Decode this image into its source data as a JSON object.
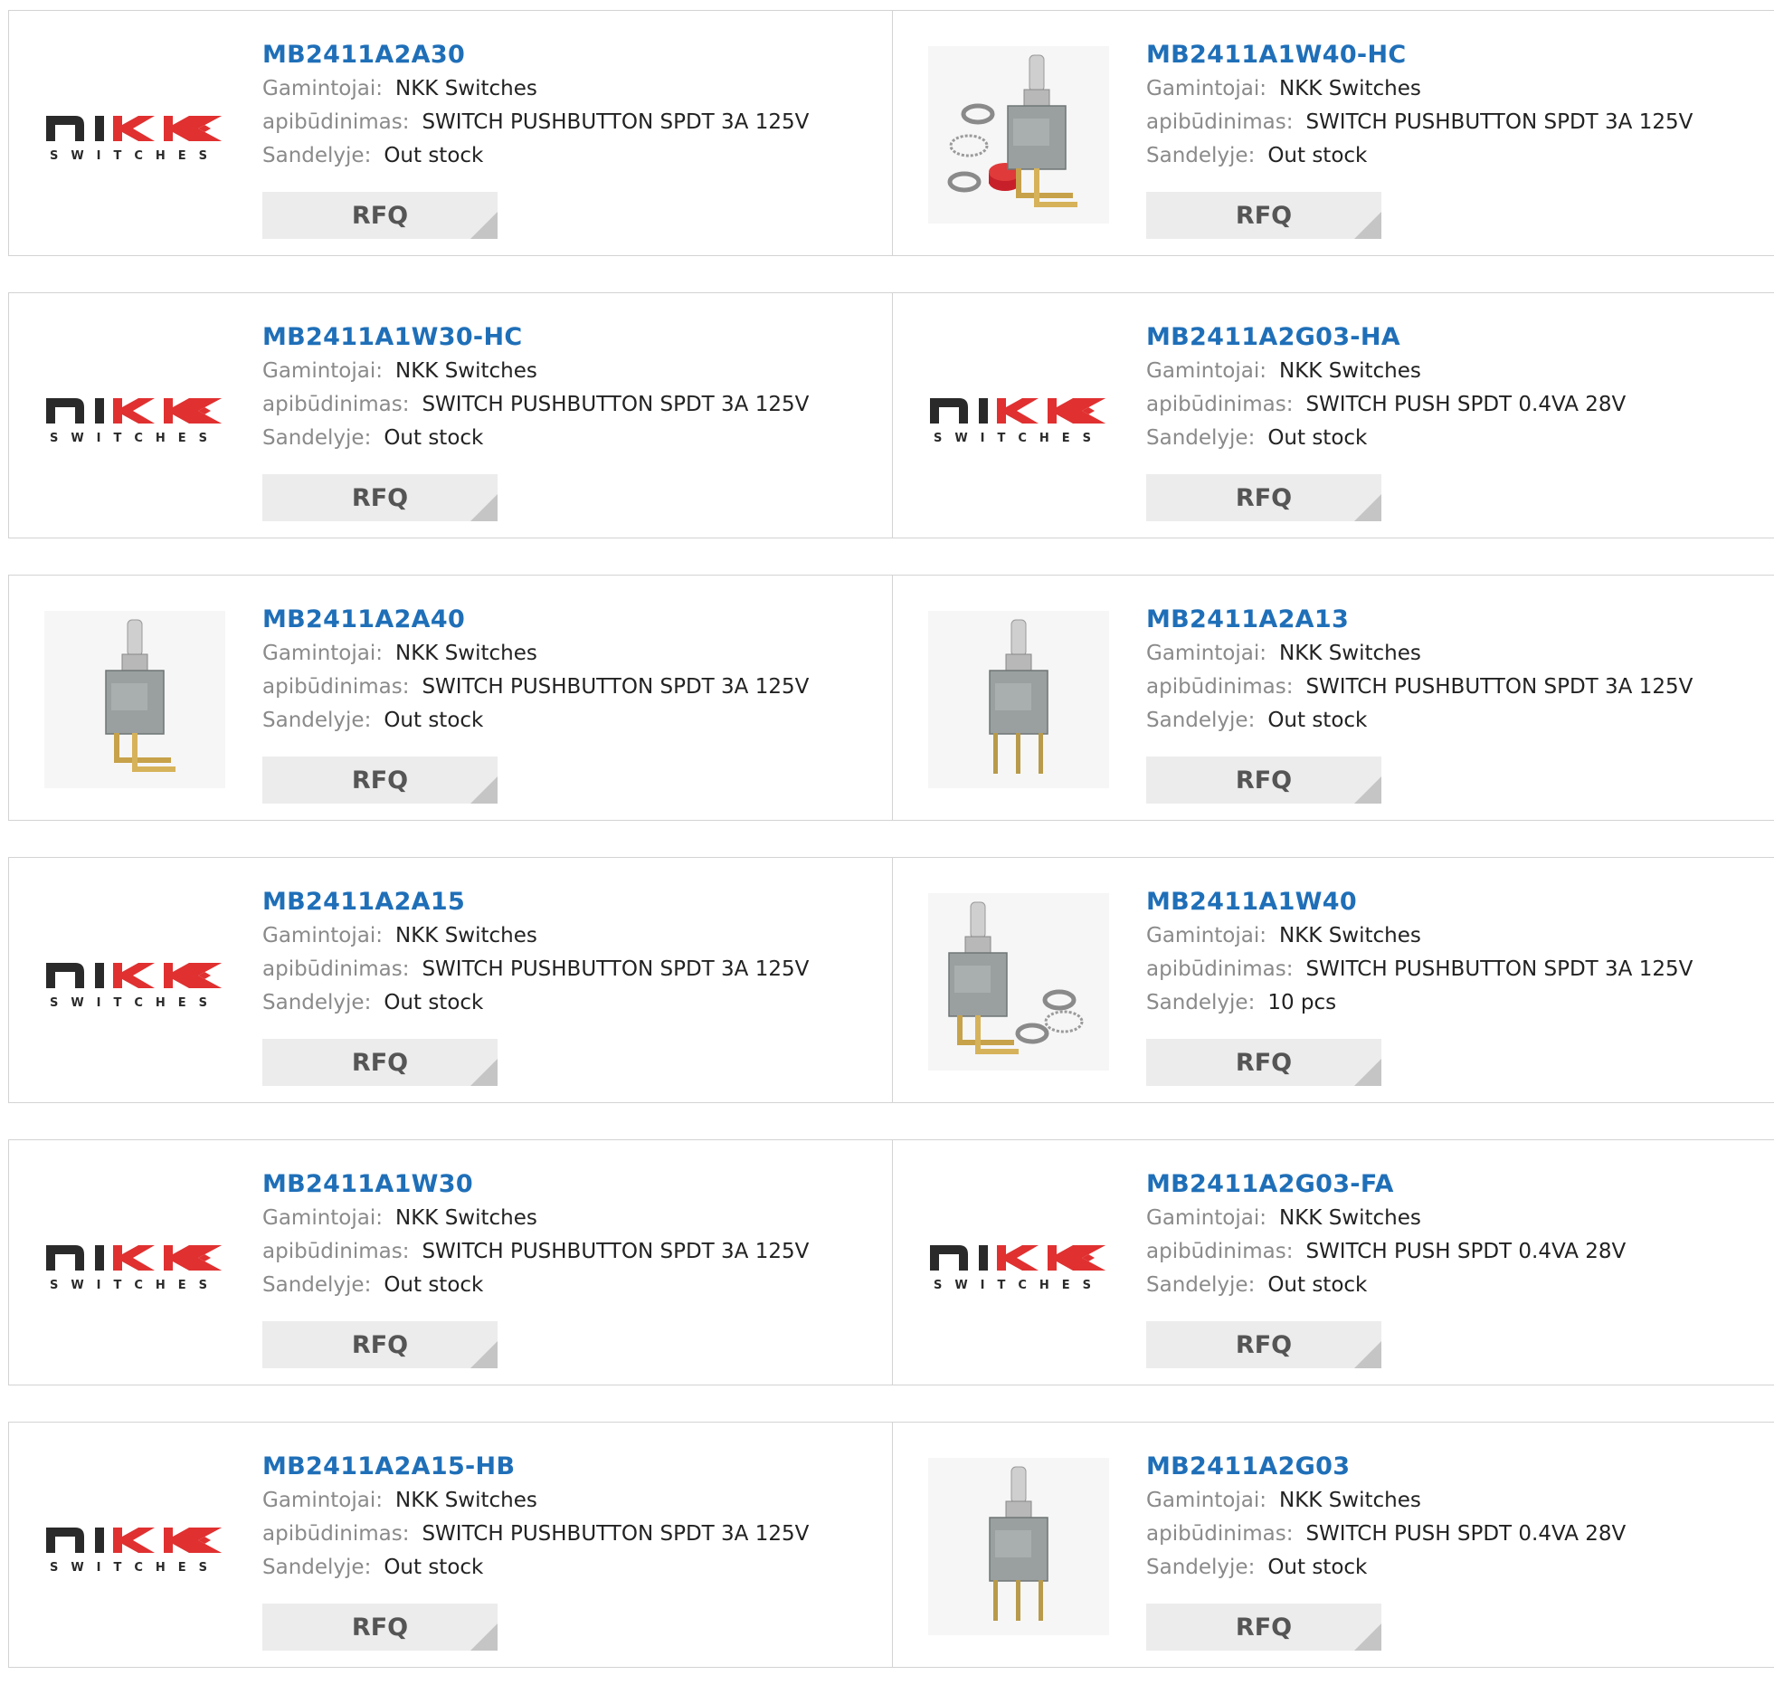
{
  "labels": {
    "manufacturer": "Gamintojai:",
    "description": "apibūdinimas:",
    "stock": "Sandelyje:",
    "rfq": "RFQ"
  },
  "logo": {
    "text_top": "NKK",
    "text_bottom": "SWITCHES",
    "color_dark": "#2a2a2a",
    "color_red": "#e03030"
  },
  "colors": {
    "part_number": "#1f6fb8",
    "rfq_bg": "#ececec",
    "rfq_corner": "#c5c5c5"
  },
  "products": [
    {
      "part": "MB2411A2A30",
      "manufacturer": "NKK Switches",
      "description": "SWITCH PUSHBUTTON SPDT 3A 125V",
      "stock": "Out stock",
      "image": "nkk-logo"
    },
    {
      "part": "MB2411A1W40-HC",
      "manufacturer": "NKK Switches",
      "description": "SWITCH PUSHBUTTON SPDT 3A 125V",
      "stock": "Out stock",
      "image": "switch-photo-with-red-cap"
    },
    {
      "part": "MB2411A1W30-HC",
      "manufacturer": "NKK Switches",
      "description": "SWITCH PUSHBUTTON SPDT 3A 125V",
      "stock": "Out stock",
      "image": "nkk-logo"
    },
    {
      "part": "MB2411A2G03-HA",
      "manufacturer": "NKK Switches",
      "description": "SWITCH PUSH SPDT 0.4VA 28V",
      "stock": "Out stock",
      "image": "nkk-logo"
    },
    {
      "part": "MB2411A2A40",
      "manufacturer": "NKK Switches",
      "description": "SWITCH PUSHBUTTON SPDT 3A 125V",
      "stock": "Out stock",
      "image": "switch-photo-right-angle"
    },
    {
      "part": "MB2411A2A13",
      "manufacturer": "NKK Switches",
      "description": "SWITCH PUSHBUTTON SPDT 3A 125V",
      "stock": "Out stock",
      "image": "switch-photo-vertical"
    },
    {
      "part": "MB2411A2A15",
      "manufacturer": "NKK Switches",
      "description": "SWITCH PUSHBUTTON SPDT 3A 125V",
      "stock": "Out stock",
      "image": "nkk-logo"
    },
    {
      "part": "MB2411A1W40",
      "manufacturer": "NKK Switches",
      "description": "SWITCH PUSHBUTTON SPDT 3A 125V",
      "stock": "10 pcs",
      "image": "switch-photo-with-washers"
    },
    {
      "part": "MB2411A1W30",
      "manufacturer": "NKK Switches",
      "description": "SWITCH PUSHBUTTON SPDT 3A 125V",
      "stock": "Out stock",
      "image": "nkk-logo"
    },
    {
      "part": "MB2411A2G03-FA",
      "manufacturer": "NKK Switches",
      "description": "SWITCH PUSH SPDT 0.4VA 28V",
      "stock": "Out stock",
      "image": "nkk-logo"
    },
    {
      "part": "MB2411A2A15-HB",
      "manufacturer": "NKK Switches",
      "description": "SWITCH PUSHBUTTON SPDT 3A 125V",
      "stock": "Out stock",
      "image": "nkk-logo"
    },
    {
      "part": "MB2411A2G03",
      "manufacturer": "NKK Switches",
      "description": "SWITCH PUSH SPDT 0.4VA 28V",
      "stock": "Out stock",
      "image": "switch-photo-vertical-pins"
    }
  ]
}
